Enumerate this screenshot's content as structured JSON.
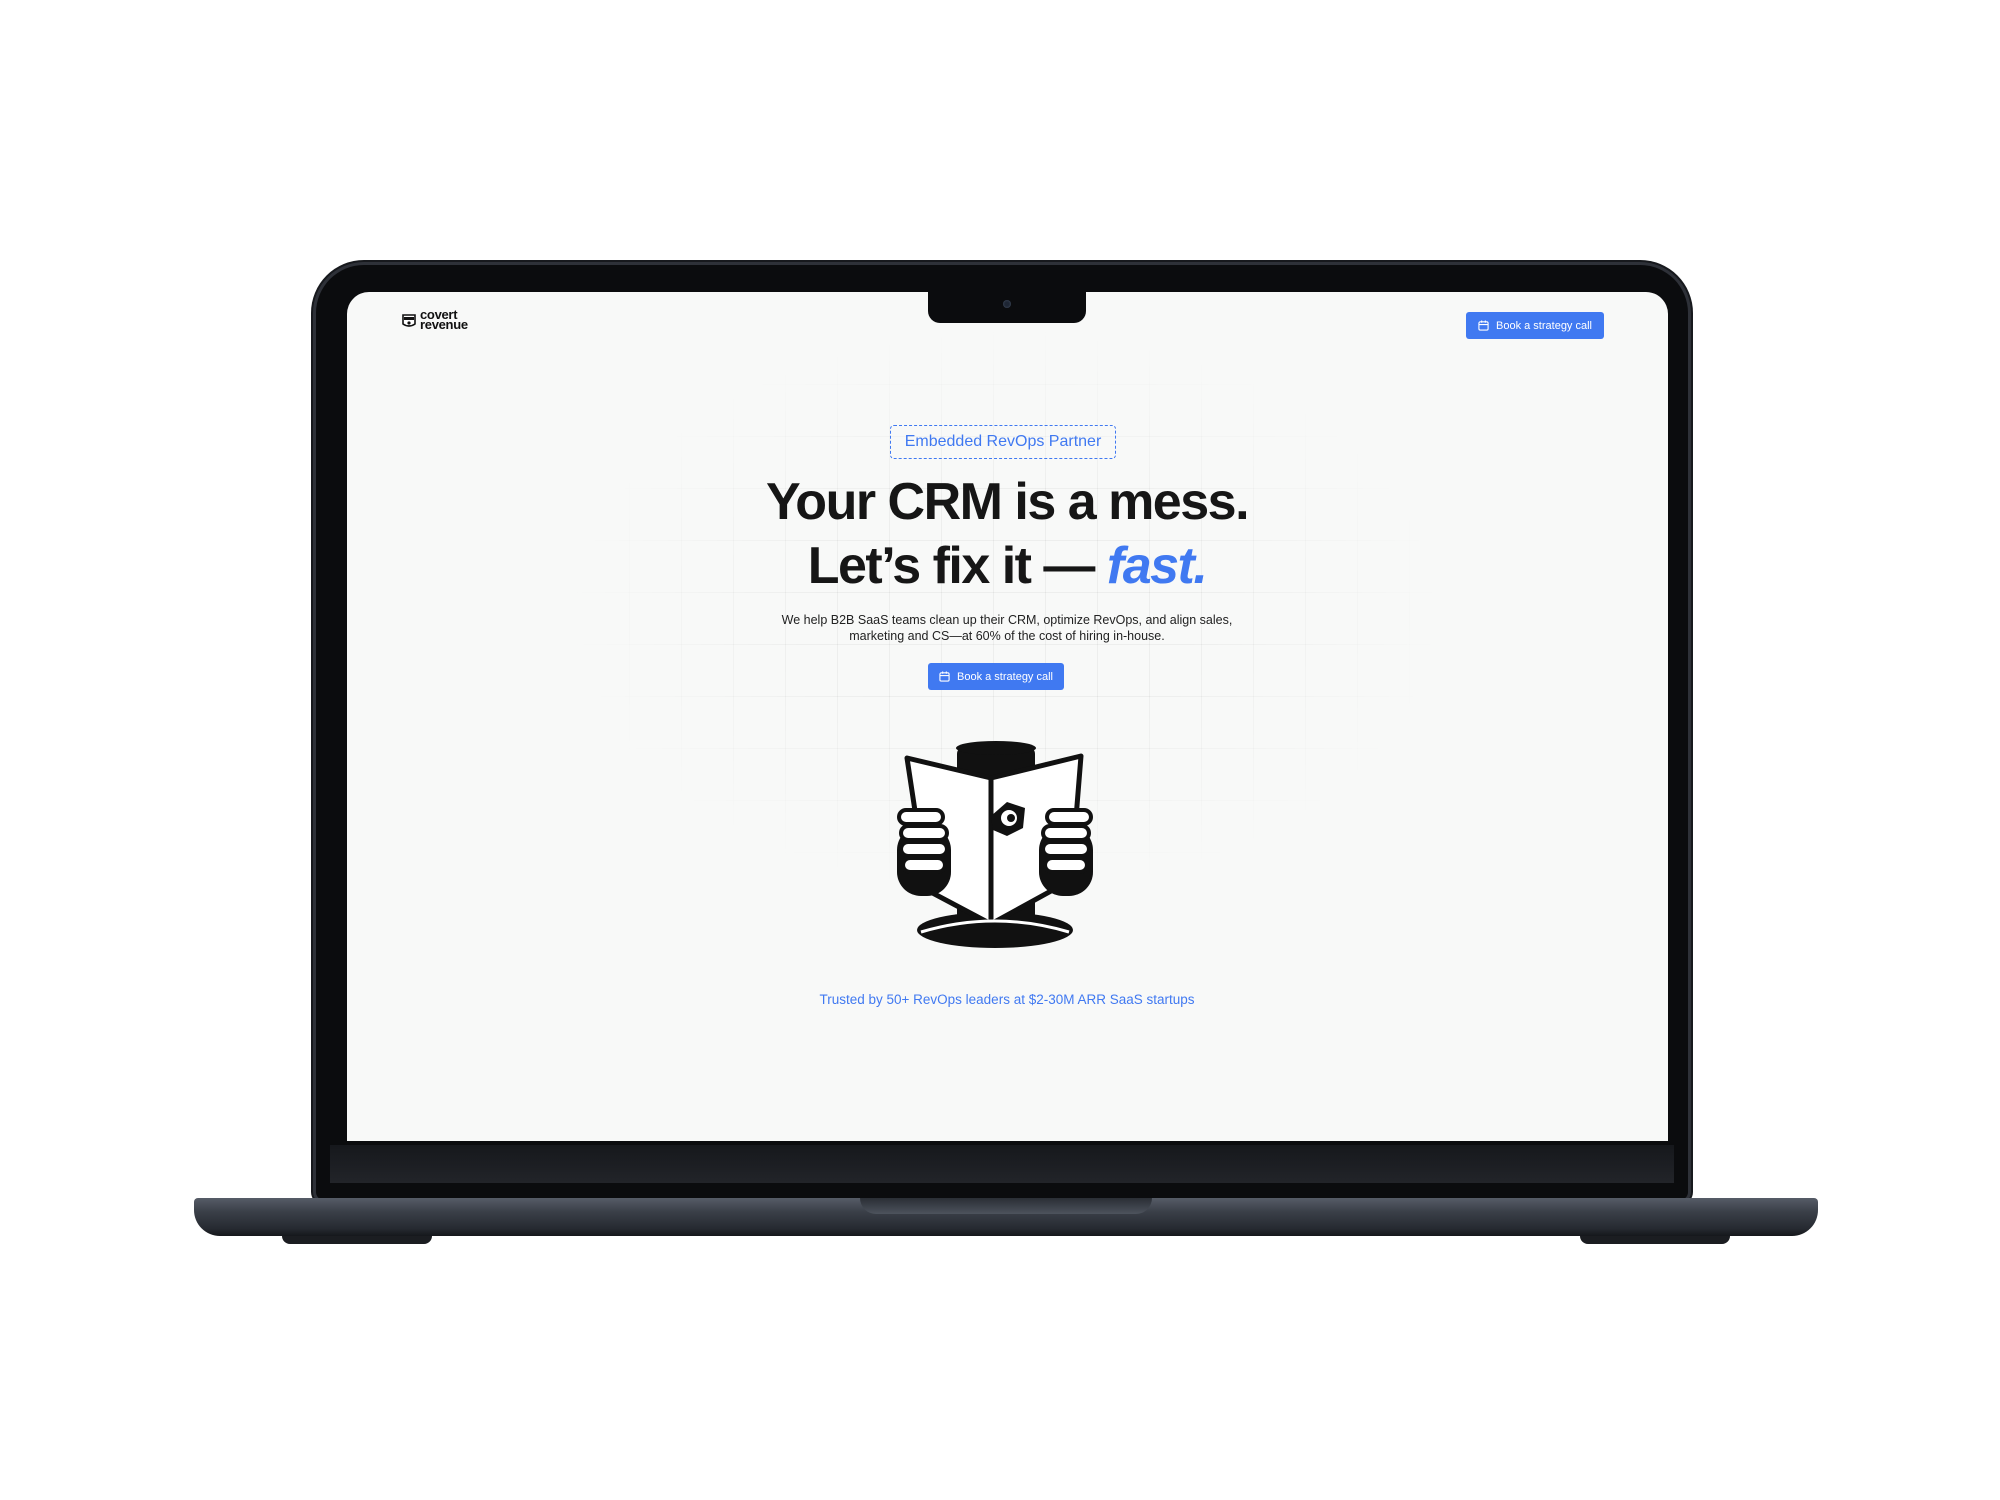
{
  "header": {
    "logo_line1": "covert",
    "logo_line2": "revenue",
    "cta_label": "Book a strategy call",
    "cta_icon": "calendar-icon"
  },
  "hero": {
    "badge": "Embedded RevOps Partner",
    "headline_line1": "Your CRM is a mess.",
    "headline_line2_prefix": "Let’s fix it — ",
    "headline_line2_accent": "fast.",
    "subtitle": "We help B2B SaaS teams clean up their CRM, optimize RevOps, and align sales, marketing and CS—at 60% of the cost of hiring in-house.",
    "cta_label": "Book a strategy call",
    "cta_icon": "calendar-icon",
    "illustration": "spy-reading-newspaper-illustration"
  },
  "trust_line": "Trusted by 50+ RevOps leaders at $2-30M ARR SaaS startups",
  "colors": {
    "accent": "#4079f1",
    "text": "#161616",
    "page_background": "#f8f9f8",
    "device_frame": "#0b0c0e"
  }
}
